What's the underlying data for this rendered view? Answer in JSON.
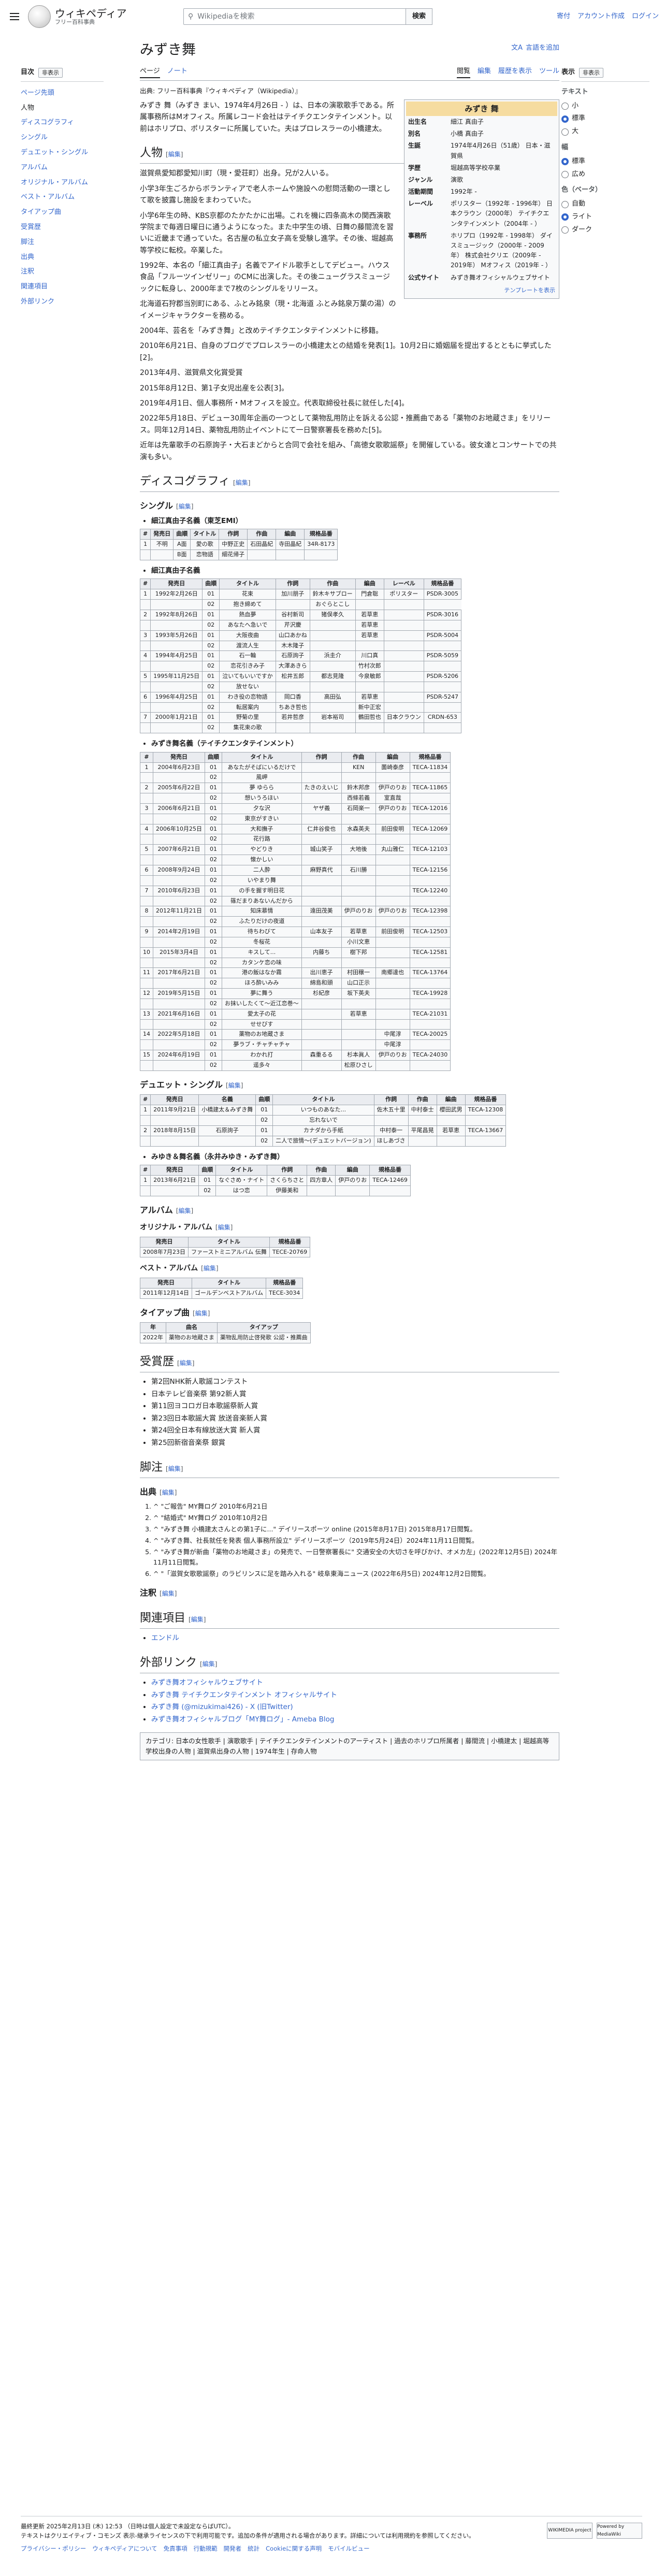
{
  "header": {
    "wordmark": "ウィキペディア",
    "tagline": "フリー百科事典",
    "search_placeholder": "Wikipediaを検索",
    "search_button": "検索",
    "links": [
      "寄付",
      "アカウント作成",
      "ログイン"
    ]
  },
  "sidebar": {
    "title": "目次",
    "hide": "非表示",
    "items": [
      {
        "label": "ページ先頭",
        "lvl": 0
      },
      {
        "label": "人物",
        "lvl": 0
      },
      {
        "label": "ディスコグラフィ",
        "lvl": 0
      },
      {
        "label": "シングル",
        "lvl": 1
      },
      {
        "label": "デュエット・シングル",
        "lvl": 1
      },
      {
        "label": "アルバム",
        "lvl": 1
      },
      {
        "label": "オリジナル・アルバム",
        "lvl": 2
      },
      {
        "label": "ベスト・アルバム",
        "lvl": 2
      },
      {
        "label": "タイアップ曲",
        "lvl": 1
      },
      {
        "label": "受賞歴",
        "lvl": 0
      },
      {
        "label": "脚注",
        "lvl": 0
      },
      {
        "label": "出典",
        "lvl": 1
      },
      {
        "label": "注釈",
        "lvl": 1
      },
      {
        "label": "関連項目",
        "lvl": 0
      },
      {
        "label": "外部リンク",
        "lvl": 0
      }
    ]
  },
  "page": {
    "title": "みずき舞",
    "lang": "言語を追加",
    "tabs_left": [
      "ページ",
      "ノート"
    ],
    "tabs_right": [
      "閲覧",
      "編集",
      "履歴を表示",
      "ツール"
    ],
    "from": "出典: フリー百科事典『ウィキペディア（Wikipedia）』"
  },
  "infobox": {
    "title": "みずき 舞",
    "rows": [
      {
        "k": "出生名",
        "v": "細江 真由子"
      },
      {
        "k": "別名",
        "v": "小橋 真由子"
      },
      {
        "k": "生誕",
        "v": "1974年4月26日（51歳） 日本・滋賀県"
      },
      {
        "k": "学歴",
        "v": "堀越高等学校卒業"
      },
      {
        "k": "ジャンル",
        "v": "演歌"
      },
      {
        "k": "活動期間",
        "v": "1992年 -"
      },
      {
        "k": "レーベル",
        "v": "ポリスター（1992年 - 1996年） 日本クラウン（2000年） テイチクエンタテインメント（2004年 - ）"
      },
      {
        "k": "事務所",
        "v": "ホリプロ（1992年 - 1998年） ダイスミュージック（2000年 - 2009年） 株式会社クリエ（2009年 - 2019年） Mオフィス（2019年 - ）"
      },
      {
        "k": "公式サイト",
        "v": "みずき舞オフィシャルウェブサイト"
      }
    ],
    "template": "テンプレートを表示"
  },
  "sections": {
    "person": "人物",
    "discography": "ディスコグラフィ",
    "single": "シングル",
    "duet": "デュエット・シングル",
    "album": "アルバム",
    "orig": "オリジナル・アルバム",
    "best": "ベスト・アルバム",
    "tieup": "タイアップ曲",
    "awards": "受賞歴",
    "notes": "脚注",
    "sources": "出典",
    "annot": "注釈",
    "related": "関連項目",
    "external": "外部リンク",
    "edit": "編集"
  },
  "intro": "みずき 舞（みずき まい、1974年4月26日 - ）は、日本の演歌歌手である。所属事務所はMオフィス。所属レコード会社はテイチクエンタテインメント。以前はホリプロ、ポリスターに所属していた。夫はプロレスラーの小橋建太。",
  "person_paras": [
    "滋賀県愛知郡愛知川町（現・愛荘町）出身。兄が2人いる。",
    "小学3年生ごろからボランティアで老人ホームや施設への慰問活動の一環として歌を披露し施設をまわっていた。",
    "小学6年生の時、KBS京都のたかたかに出場。これを機に四条高木の関西演歌学院まで毎週日曜日に通うようになった。また中学生の頃、日舞の藤間流を習いに近畿まで通っていた。名古屋の私立女子高を受験し進学。その後、堀越高等学校に転校。卒業した。",
    "1992年、本名の「細江真由子」名義でアイドル歌手としてデビュー。ハウス食品「フルーツインゼリー」のCMに出演した。その後ニューグラスミュージックに転身し、2000年まで7枚のシングルをリリース。",
    "北海道石狩郡当別町にある、ふとみ銘泉（現・北海道 ふとみ銘泉万葉の湯）のイメージキャラクターを務める。",
    "2004年、芸名を「みずき舞」と改めテイチクエンタテインメントに移籍。",
    "2010年6月21日、自身のブログでプロレスラーの小橋建太との結婚を発表[1]。10月2日に婚姻届を提出するとともに挙式した[2]。",
    "2013年4月、滋賀県文化賞受賞",
    "2015年8月12日、第1子女児出産を公表[3]。",
    "2019年4月1日、個人事務所・Mオフィスを設立。代表取締役社長に就任した[4]。",
    "2022年5月18日、デビュー30周年企画の一つとして薬物乱用防止を訴える公認・推薦曲である「薬物のお地蔵さま」をリリース。同年12月14日、薬物乱用防止イベントにて一日警察署長を務めた[5]。",
    "近年は先輩歌手の石原詢子・大石まどからと合同で会社を組み、「高徳女歌歌謡祭」を開催している。彼女達とコンサートでの共演も多い。"
  ],
  "tables": {
    "s1_label": "細江真由子名義（東芝EMI）",
    "s1_head": [
      "#",
      "発売日",
      "曲順",
      "タイトル",
      "作詞",
      "作曲",
      "編曲",
      "規格品番"
    ],
    "s1_rows": [
      [
        "1",
        "不明",
        "A面",
        "愛の歌",
        "中野正史",
        "石田晶紀",
        "寺田晶紀",
        "34R-8173"
      ],
      [
        "",
        "",
        "B面",
        "恋物語",
        "細花帰子",
        "",
        "",
        ""
      ]
    ],
    "s2_label": "細江真由子名義",
    "s2_head": [
      "#",
      "発売日",
      "曲順",
      "タイトル",
      "作詞",
      "作曲",
      "編曲",
      "レーベル",
      "規格品番"
    ],
    "s2_rows": [
      [
        "1",
        "1992年2月26日",
        "01",
        "花束",
        "加川朋子",
        "鈴木キサブロー",
        "門倉聡",
        "ポリスター",
        "PSDR-3005"
      ],
      [
        "",
        "",
        "02",
        "抱き締めて",
        "",
        "おぐらとこし",
        "",
        ""
      ],
      [
        "2",
        "1992年8月26日",
        "01",
        "熱血夢",
        "谷村新司",
        "猪俣孝久",
        "若草恵",
        "",
        "PSDR-3016"
      ],
      [
        "",
        "",
        "02",
        "あなたへ急いで",
        "芹沢慶",
        "",
        "若草恵",
        "",
        ""
      ],
      [
        "3",
        "1993年5月26日",
        "01",
        "大阪夜曲",
        "山口あかね",
        "",
        "若草恵",
        "",
        "PSDR-5004"
      ],
      [
        "",
        "",
        "02",
        "渡流人生",
        "木木隆子",
        "",
        "",
        "",
        ""
      ],
      [
        "4",
        "1994年4月25日",
        "01",
        "石一輪",
        "石原詢子",
        "浜圭介",
        "川口真",
        "",
        "PSDR-5059"
      ],
      [
        "",
        "",
        "02",
        "恋花引きみ子",
        "大澤あきら",
        "",
        "竹村次郎",
        "",
        ""
      ],
      [
        "5",
        "1995年11月25日",
        "01",
        "泣いてもいいですか",
        "松井五郎",
        "都志見隆",
        "今泉敏郎",
        "",
        "PSDR-5206"
      ],
      [
        "",
        "",
        "02",
        "放せない",
        "",
        "",
        "",
        "",
        ""
      ],
      [
        "6",
        "1996年4月25日",
        "01",
        "わき役の恋物語",
        "岡口香",
        "高田弘",
        "若草恵",
        "",
        "PSDR-5247"
      ],
      [
        "",
        "",
        "02",
        "転居案内",
        "ちあき哲也",
        "",
        "新中正宏",
        "",
        ""
      ],
      [
        "7",
        "2000年1月21日",
        "01",
        "野菊の里",
        "若井哲彦",
        "岩本裕司",
        "鶴田哲也",
        "日本クラウン",
        "CRDN-653"
      ],
      [
        "",
        "",
        "02",
        "集花束の歌",
        "",
        "",
        "",
        "",
        ""
      ]
    ],
    "s3_label": "みずき舞名義（テイチクエンタテインメント）",
    "s3_head": [
      "#",
      "発売日",
      "曲順",
      "タイトル",
      "作詞",
      "作曲",
      "編曲",
      "規格品番"
    ],
    "s3_rows": [
      [
        "1",
        "2004年6月23日",
        "01",
        "あなたがそばにいるだけで",
        "",
        "KEN",
        "薗崎泰彦",
        "TECA-11834"
      ],
      [
        "",
        "",
        "02",
        "風岬",
        "",
        "",
        "",
        ""
      ],
      [
        "2",
        "2005年6月22日",
        "01",
        "夢 ゆらら",
        "たきのえいじ",
        "鈴木邦彦",
        "伊戸のりお",
        "TECA-11865"
      ],
      [
        "",
        "",
        "02",
        "想いうろほい",
        "",
        "西條若義",
        "室直哉",
        ""
      ],
      [
        "3",
        "2006年6月21日",
        "01",
        "夕な沢",
        "ヤザ義",
        "石岡楽一",
        "伊戸のりお",
        "TECA-12016"
      ],
      [
        "",
        "",
        "02",
        "東京がすきい",
        "",
        "",
        "",
        ""
      ],
      [
        "4",
        "2006年10月25日",
        "01",
        "大和撫子",
        "仁井谷俊也",
        "水森英夫",
        "前田俊明",
        "TECA-12069"
      ],
      [
        "",
        "",
        "02",
        "花行路",
        "",
        "",
        "",
        ""
      ],
      [
        "5",
        "2007年6月21日",
        "01",
        "やどりき",
        "城山笑子",
        "大地後",
        "丸山雅仁",
        "TECA-12103"
      ],
      [
        "",
        "",
        "02",
        "懐かしい",
        "",
        "",
        "",
        ""
      ],
      [
        "6",
        "2008年9月24日",
        "01",
        "二人酔",
        "麻野真代",
        "石川勝",
        "",
        "TECA-12156"
      ],
      [
        "",
        "",
        "02",
        "いやまり舞",
        "",
        "",
        "",
        ""
      ],
      [
        "7",
        "2010年6月23日",
        "01",
        "の手を握す明日花",
        "",
        "",
        "",
        "TECA-12240"
      ],
      [
        "",
        "",
        "02",
        "篠だまりあないんだから",
        "",
        "",
        "",
        ""
      ],
      [
        "8",
        "2012年11月21日",
        "01",
        "知床慕情",
        "遠田茂美",
        "伊戸のりお",
        "伊戸のりお",
        "TECA-12398"
      ],
      [
        "",
        "",
        "02",
        "ふたりだけの夜道",
        "",
        "",
        "",
        ""
      ],
      [
        "9",
        "2014年2月19日",
        "01",
        "待ちわびて",
        "山本友子",
        "若草恵",
        "前田俊明",
        "TECA-12503"
      ],
      [
        "",
        "",
        "02",
        "冬桜花",
        "",
        "小川文恵",
        "",
        ""
      ],
      [
        "10",
        "2015年3月4日",
        "01",
        "キスして...",
        "内藤ち",
        "樹下邦",
        "",
        "TECA-12581"
      ],
      [
        "",
        "",
        "02",
        "カタンケ恋の味",
        "",
        "",
        "",
        ""
      ],
      [
        "11",
        "2017年6月21日",
        "01",
        "港の飯はなか霧",
        "出川恵子",
        "村田穣一",
        "南郷達也",
        "TECA-13764"
      ],
      [
        "",
        "",
        "02",
        "ほろ酔いみみ",
        "綿島和頭",
        "山口正示",
        "",
        ""
      ],
      [
        "12",
        "2019年5月15日",
        "01",
        "夢に舞う",
        "杉紀彦",
        "坂下英夫",
        "",
        "TECA-19928"
      ],
      [
        "",
        "",
        "02",
        "お抹いしたくて〜近江恋巻〜",
        "",
        "",
        "",
        ""
      ],
      [
        "13",
        "2021年6月16日",
        "01",
        "愛太子の花",
        "",
        "若草恵",
        "",
        "TECA-21031"
      ],
      [
        "",
        "",
        "02",
        "せせびす",
        "",
        "",
        "",
        ""
      ],
      [
        "14",
        "2022年5月18日",
        "01",
        "薬物のお地蔵さま",
        "",
        "",
        "中尾淳",
        "TECA-20025"
      ],
      [
        "",
        "",
        "02",
        "夢ラブ・チャチャチャ",
        "",
        "",
        "中尾淳",
        ""
      ],
      [
        "15",
        "2024年6月19日",
        "01",
        "わかれ打",
        "森重るる",
        "杉本眞人",
        "伊戸のりお",
        "TECA-24030"
      ],
      [
        "",
        "",
        "02",
        "遥多々",
        "",
        "松原ひさし",
        "",
        ""
      ]
    ],
    "d_head": [
      "#",
      "発売日",
      "名義",
      "曲順",
      "タイトル",
      "作詞",
      "作曲",
      "編曲",
      "規格品番"
    ],
    "d_rows": [
      [
        "1",
        "2011年9月21日",
        "小橋建太＆みずき舞",
        "01",
        "いつものあなた...",
        "佐木五十里",
        "中村泰士",
        "櫻田武男",
        "TECA-12308"
      ],
      [
        "",
        "",
        "",
        "02",
        "忘れないで",
        "",
        "",
        "",
        ""
      ],
      [
        "2",
        "2018年8月15日",
        "石原詢子",
        "01",
        "カナダから手紙",
        "中村泰一",
        "平尾昌晃",
        "若草恵",
        "TECA-13667"
      ],
      [
        "",
        "",
        "",
        "02",
        "二人で旅情〜(デュエットバージョン)",
        "ほしあづさ",
        "",
        "",
        ""
      ]
    ],
    "m_label": "みゆき＆舞名義（永井みゆき・みずき舞）",
    "m_head": [
      "#",
      "発売日",
      "曲順",
      "タイトル",
      "作詞",
      "作曲",
      "編曲",
      "規格品番"
    ],
    "m_rows": [
      [
        "1",
        "2013年6月21日",
        "01",
        "なぐさめ・ナイト",
        "さくらちさと",
        "四方章人",
        "伊戸のりお",
        "TECA-12469"
      ],
      [
        "",
        "",
        "02",
        "はつ恋",
        "伊藤美和",
        "",
        "",
        ""
      ]
    ],
    "a_head": [
      "発売日",
      "タイトル",
      "規格品番"
    ],
    "a_rows": [
      [
        "2008年7月23日",
        "ファーストミニアルバム 伝舞",
        "TECE-20769"
      ]
    ],
    "b_rows": [
      [
        "2011年12月14日",
        "ゴールデンベストアルバム",
        "TECE-3034"
      ]
    ],
    "t_head": [
      "年",
      "曲名",
      "タイアップ"
    ],
    "t_rows": [
      [
        "2022年",
        "薬物のお地蔵さま",
        "薬物乱用防止啓発歌 公認・推薦曲"
      ]
    ]
  },
  "awards": [
    "第2回NHK新人歌謡コンテスト",
    "日本テレビ音楽祭 第92新人賞",
    "第11回ヨコロガ日本歌謡祭新人賞",
    "第23回日本歌謡大賞 放送音楽新人賞",
    "第24回全日本有線放送大賞 新人賞",
    "第25回新宿音楽祭 銀賞"
  ],
  "refs": [
    "^ \"ご報告\" MY舞ログ 2010年6月21日",
    "^ \"結婚式\" MY舞ログ 2010年10月2日",
    "^ \"みずき舞 小橋建太さんとの第1子に...\" デイリースポーツ online (2015年8月17日) 2015年8月17日閲覧。",
    "^ \"みずき舞、社長就任を発表 個人事務所設立\" デイリースポーツ（2019年5月24日）2024年11月11日閲覧。",
    "^ \"みずき舞が新曲「薬物のお地蔵さま」の発売で、一日警察署長に\" 交通安全の大切さを呼びかけ、オメカ左」(2022年12月5日) 2024年11月11日閲覧。",
    "^ \"「滋賀女歌歌謡祭」のラビリンスに足を踏み入れる\" 岐阜東海ニュース (2022年6月5日) 2024年12月2日閲覧。"
  ],
  "related": [
    "エンドル"
  ],
  "external": [
    "みずき舞オフィシャルウェブサイト",
    "みずき舞 テイチクエンタテインメント オフィシャルサイト",
    "みずき舞 (@mizukimai426) - X (旧Twitter)",
    "みずき舞オフィシャルブログ「MY舞ログ」- Ameba Blog"
  ],
  "categories": "カテゴリ: 日本の女性歌手 | 演歌歌手 | テイチクエンタテインメントのアーティスト | 過去のホリプロ所属者 | 藤間流 | 小橋建太 | 堀越高等学校出身の人物 | 滋賀県出身の人物 | 1974年生 | 存命人物",
  "tools": {
    "title": "表示",
    "hide": "非表示",
    "text": "テキスト",
    "size": [
      "小",
      "標準",
      "大"
    ],
    "width": "幅",
    "width_opt": [
      "標準",
      "広め"
    ],
    "color": "色（ベータ）",
    "color_opt": [
      "自動",
      "ライト",
      "ダーク"
    ]
  },
  "footer": {
    "updated": "最終更新 2025年2月13日 (木) 12:53 （日時は個人設定で未設定ならばUTC）。",
    "license": "テキストはクリエイティブ・コモンズ 表示-継承ライセンスの下で利用可能です。追加の条件が適用される場合があります。詳細については利用規約を参照してください。",
    "links": [
      "プライバシー・ポリシー",
      "ウィキペディアについて",
      "免責事項",
      "行動規範",
      "開発者",
      "統計",
      "Cookieに関する声明",
      "モバイルビュー"
    ],
    "badges": [
      "WIKIMEDIA project",
      "Powered by MediaWiki"
    ]
  }
}
